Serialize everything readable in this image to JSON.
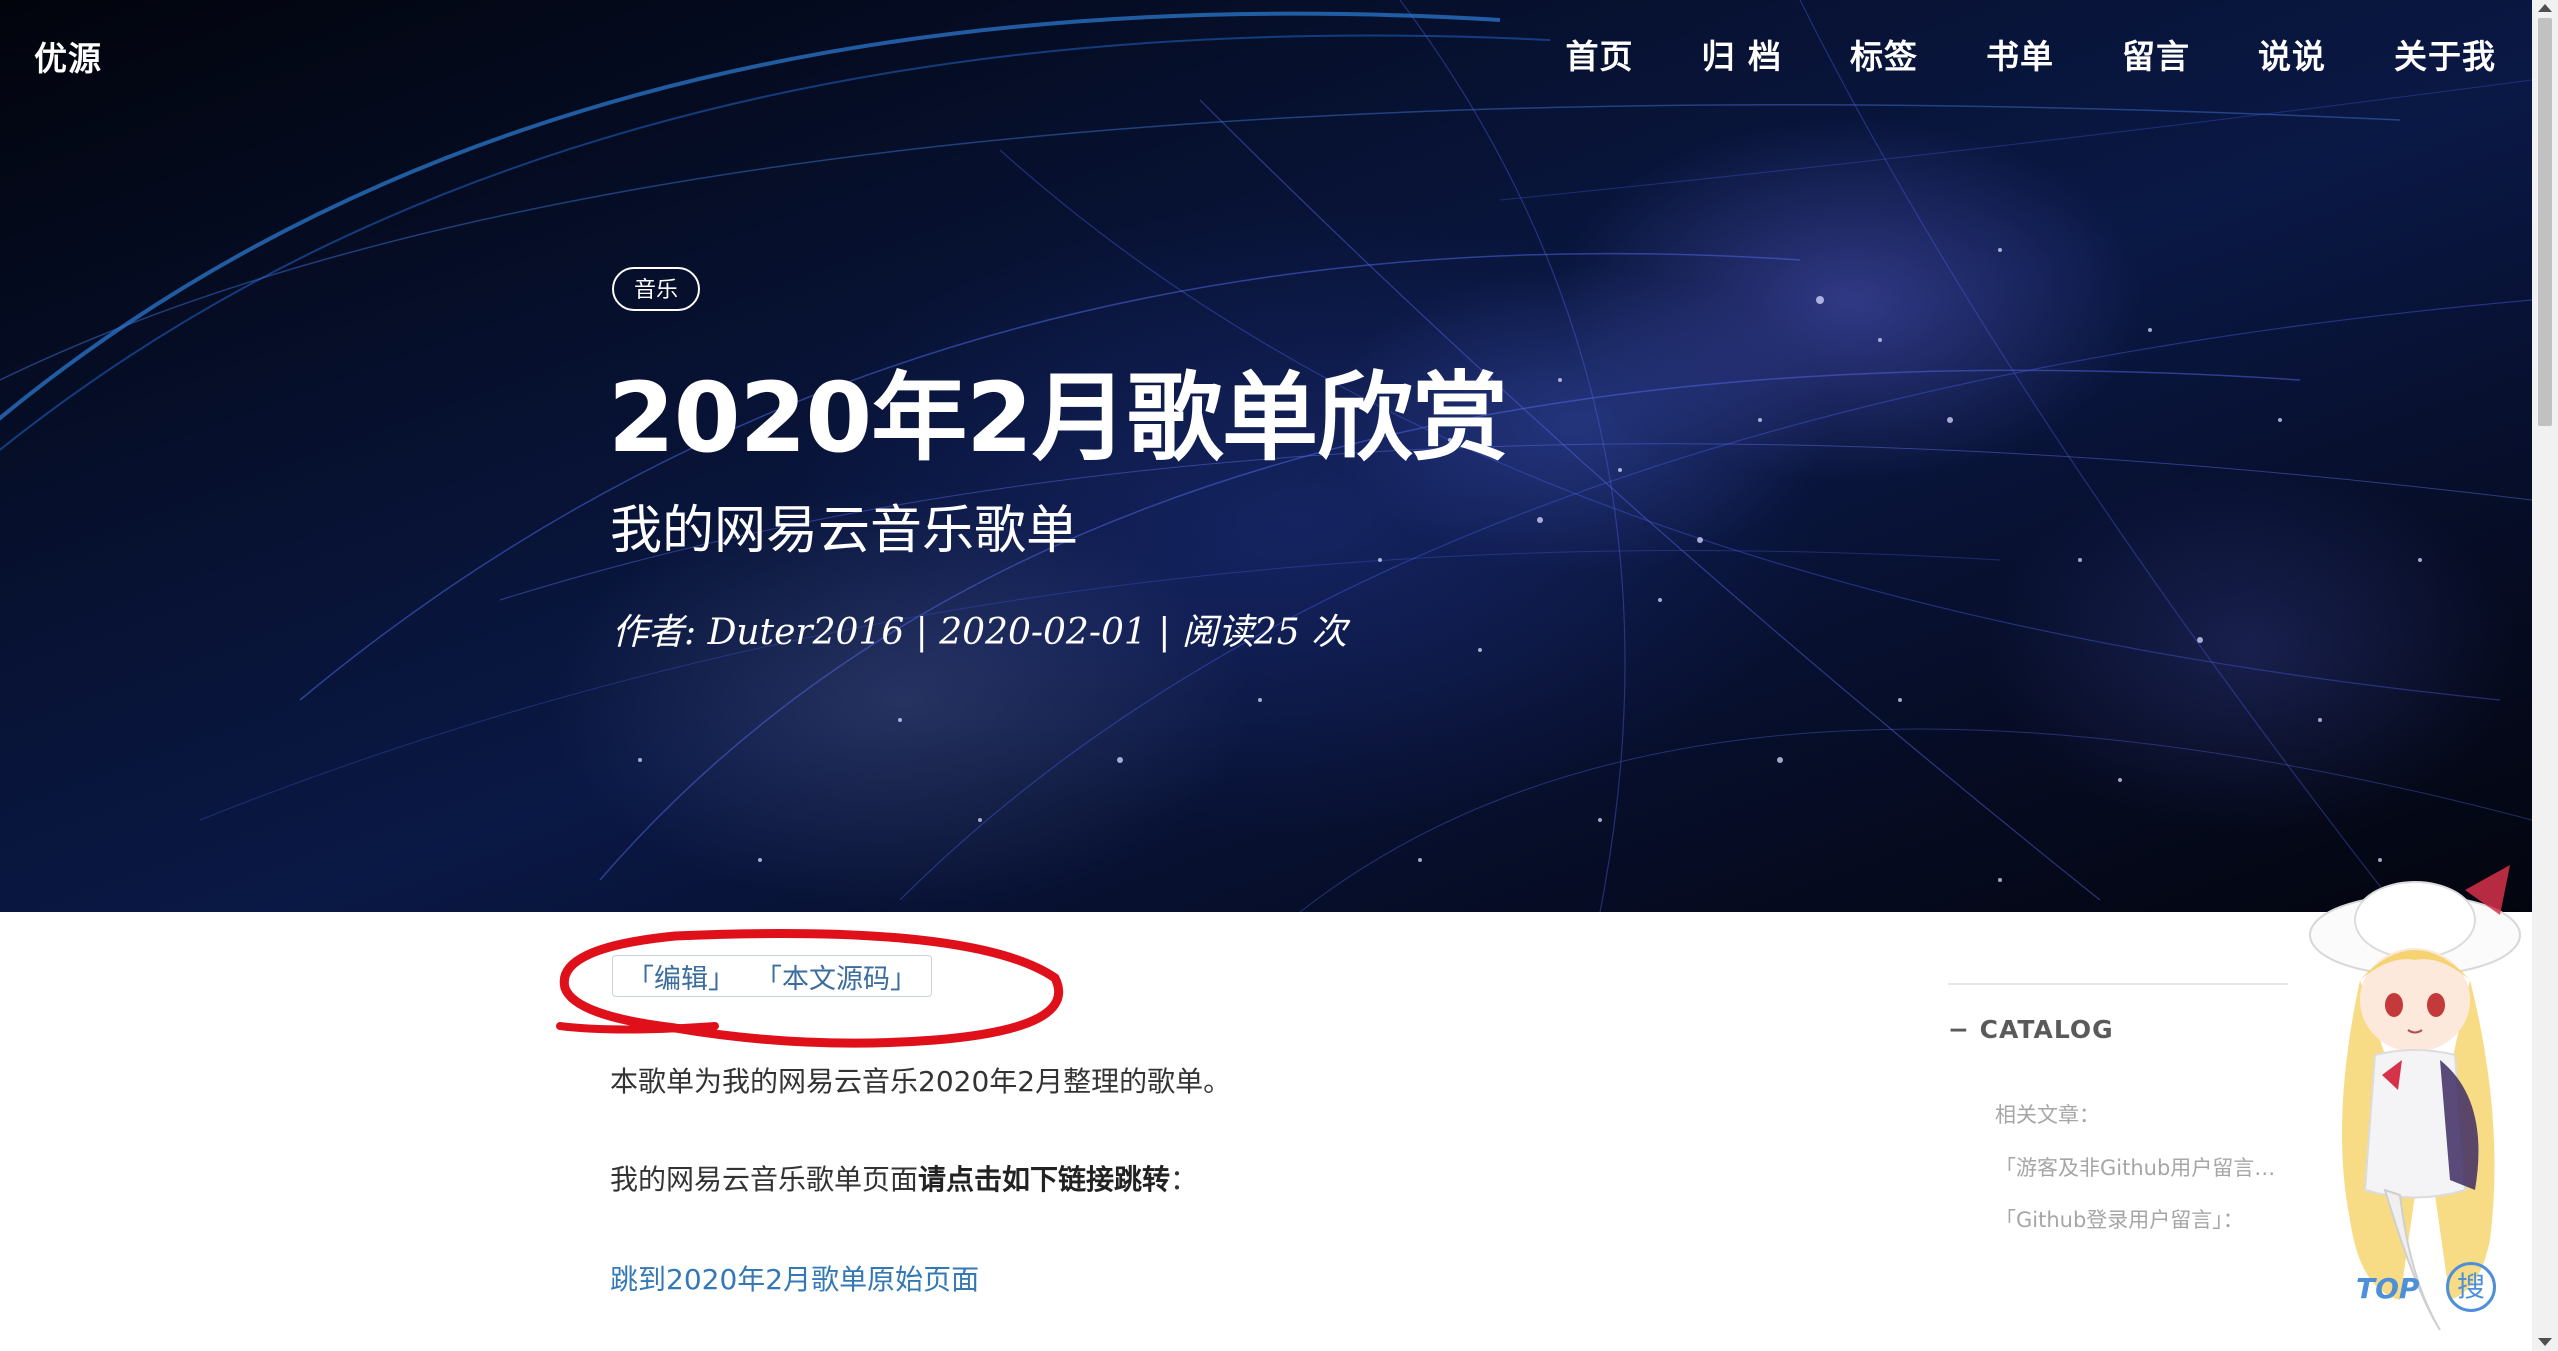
{
  "header": {
    "brand": "优源",
    "nav": [
      "首页",
      "归 档",
      "标签",
      "书单",
      "留言",
      "说说",
      "关于我"
    ]
  },
  "post": {
    "tag": "音乐",
    "title": "2020年2月歌单欣赏",
    "subtitle": "我的网易云音乐歌单",
    "meta": "作者: Duter2016 | 2020-02-01 | 阅读25 次"
  },
  "actions": {
    "edit": "「编辑」",
    "source": "「本文源码」"
  },
  "content": {
    "para1": "本歌单为我的网易云音乐2020年2月整理的歌单。",
    "para2_normal": "我的网易云音乐歌单页面",
    "para2_bold": "请点击如下链接跳转",
    "para2_tail": "：",
    "link": "跳到2020年2月歌单原始页面"
  },
  "catalog": {
    "title": "CATALOG",
    "toggle": "−",
    "items": [
      "相关文章：",
      "「游客及非Github用户留言…",
      "「Github登录用户留言」："
    ]
  },
  "widgets": {
    "top": "TOP",
    "search": "搜"
  },
  "colors": {
    "link": "#3478b5",
    "annotation": "#e0101a",
    "accent": "#4d8fd8"
  }
}
